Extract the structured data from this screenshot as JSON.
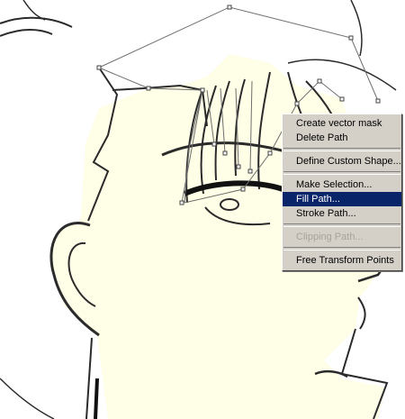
{
  "colors": {
    "skin": "#fffee6",
    "line": "#2b2b2b",
    "menu_bg": "#d4d0c8",
    "menu_highlight": "#0a246a",
    "path": "#6e6e6e"
  },
  "context_menu": {
    "items": [
      {
        "label": "Create vector mask"
      },
      {
        "label": "Delete Path"
      },
      {
        "label": "Define Custom Shape..."
      },
      {
        "label": "Make Selection..."
      },
      {
        "label": "Fill Path...",
        "highlighted": true
      },
      {
        "label": "Stroke Path..."
      },
      {
        "label": "Clipping Path...",
        "disabled": true
      },
      {
        "label": "Free Transform Points"
      }
    ]
  }
}
